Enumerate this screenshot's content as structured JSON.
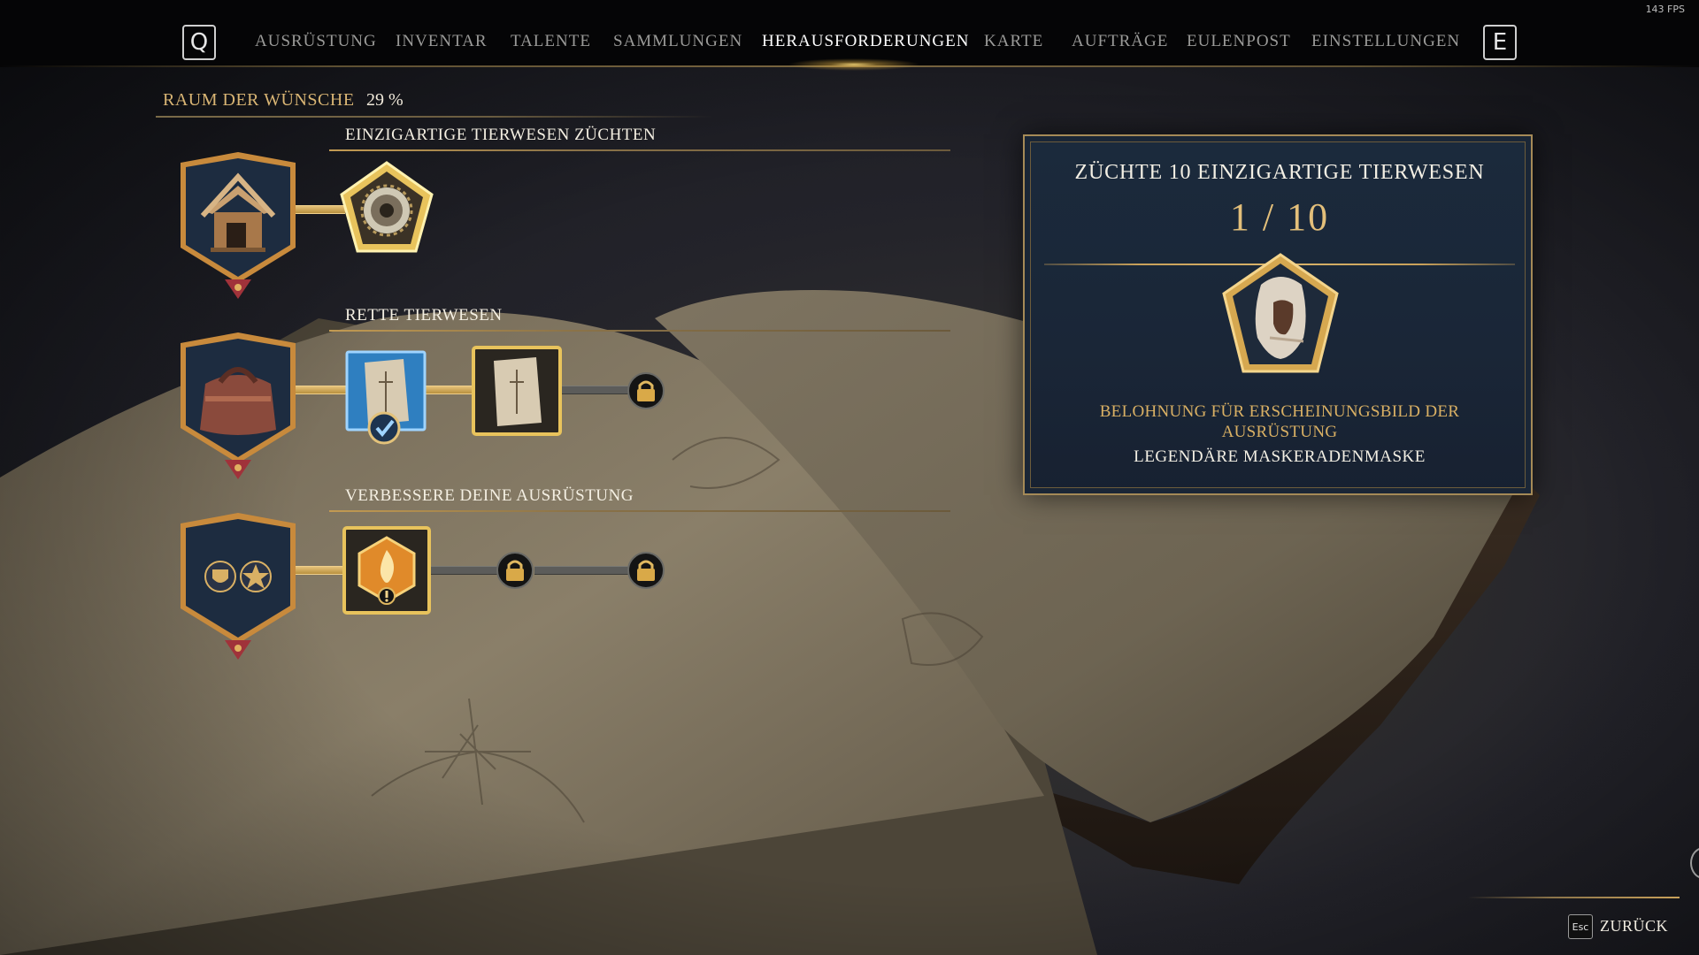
{
  "hud": {
    "fps": "143 FPS"
  },
  "nav": {
    "prev_key": "Q",
    "next_key": "E",
    "tabs": [
      {
        "label": "AUSRÜSTUNG",
        "active": false
      },
      {
        "label": "INVENTAR",
        "active": false
      },
      {
        "label": "TALENTE",
        "active": false
      },
      {
        "label": "SAMMLUNGEN",
        "active": false
      },
      {
        "label": "HERAUSFORDERUNGEN",
        "active": true
      },
      {
        "label": "KARTE",
        "active": false
      },
      {
        "label": "AUFTRÄGE",
        "active": false
      },
      {
        "label": "EULENPOST",
        "active": false
      },
      {
        "label": "EINSTELLUNGEN",
        "active": false
      }
    ]
  },
  "category": {
    "name": "RAUM DER WÜNSCHE",
    "progress": "29 %"
  },
  "challenges": [
    {
      "title": "EINZIGARTIGE TIERWESEN ZÜCHTEN",
      "crest_icon": "vivarium-hut-icon",
      "tiers": [
        {
          "state": "selected",
          "icon": "gear-ring-icon"
        }
      ]
    },
    {
      "title": "RETTE TIERWESEN",
      "crest_icon": "beast-bag-icon",
      "tiers": [
        {
          "state": "completed",
          "icon": "recipe-scroll-icon"
        },
        {
          "state": "available",
          "icon": "recipe-scroll-icon"
        },
        {
          "state": "locked",
          "icon": "lock-icon"
        }
      ]
    },
    {
      "title": "VERBESSERE DEINE AUSRÜSTUNG",
      "crest_icon": "shield-star-icon",
      "tiers": [
        {
          "state": "available",
          "icon": "flame-hexagon-icon"
        },
        {
          "state": "locked",
          "icon": "lock-icon"
        },
        {
          "state": "locked",
          "icon": "lock-icon"
        }
      ]
    }
  ],
  "detail": {
    "title": "ZÜCHTE 10 EINZIGARTIGE TIERWESEN",
    "progress": "1 / 10",
    "reward_icon": "masquerade-mask-icon",
    "reward_label": "BELOHNUNG FÜR ERSCHEINUNGSBILD DER AUSRÜSTUNG",
    "reward_name": "LEGENDÄRE MASKERADENMASKE"
  },
  "footer": {
    "esc_key": "Esc",
    "back_label": "ZURÜCK"
  },
  "colors": {
    "accent_gold": "#d9b574",
    "panel_blue": "#1b2a3c",
    "completed_blue": "#2f7fc0",
    "topbar_black": "#050506"
  }
}
